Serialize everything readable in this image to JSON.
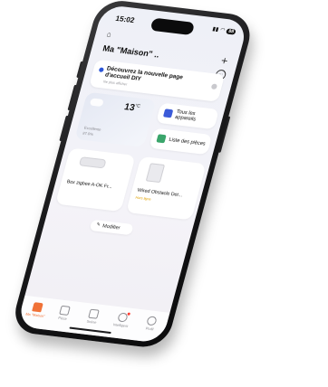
{
  "status": {
    "time": "15:02",
    "battery": "88"
  },
  "header": {
    "title": "Ma \"Maison\" .."
  },
  "banner": {
    "title": "Découvrez la nouvelle page d'accueil DIY",
    "subtitle": "Ne plus afficher"
  },
  "weather": {
    "temperature": "13",
    "unit": "°C",
    "line1": "Excellente",
    "line2": "87.0%"
  },
  "tiles": [
    {
      "label": "Tous les appareils",
      "color": "#3b5bd9"
    },
    {
      "label": "Liste des pièces",
      "color": "#3aa56b"
    }
  ],
  "devices": [
    {
      "name": "Box zigbee A-OK Fr...",
      "status": ""
    },
    {
      "name": "Wired Obstacle Det...",
      "status": "Hors ligne"
    }
  ],
  "edit": {
    "label": "Modifier"
  },
  "tabs": [
    {
      "label": "Ma \"Maison\"",
      "icon": "home-icon",
      "active": true
    },
    {
      "label": "Pièce",
      "icon": "room-icon",
      "active": false
    },
    {
      "label": "Scène",
      "icon": "scene-icon",
      "active": false
    },
    {
      "label": "Intelligent",
      "icon": "smart-icon",
      "active": false
    },
    {
      "label": "Profil",
      "icon": "profile-icon",
      "active": false
    }
  ],
  "colors": {
    "accent": "#f07238",
    "link": "#2b56d8",
    "offline": "#e0a100"
  }
}
